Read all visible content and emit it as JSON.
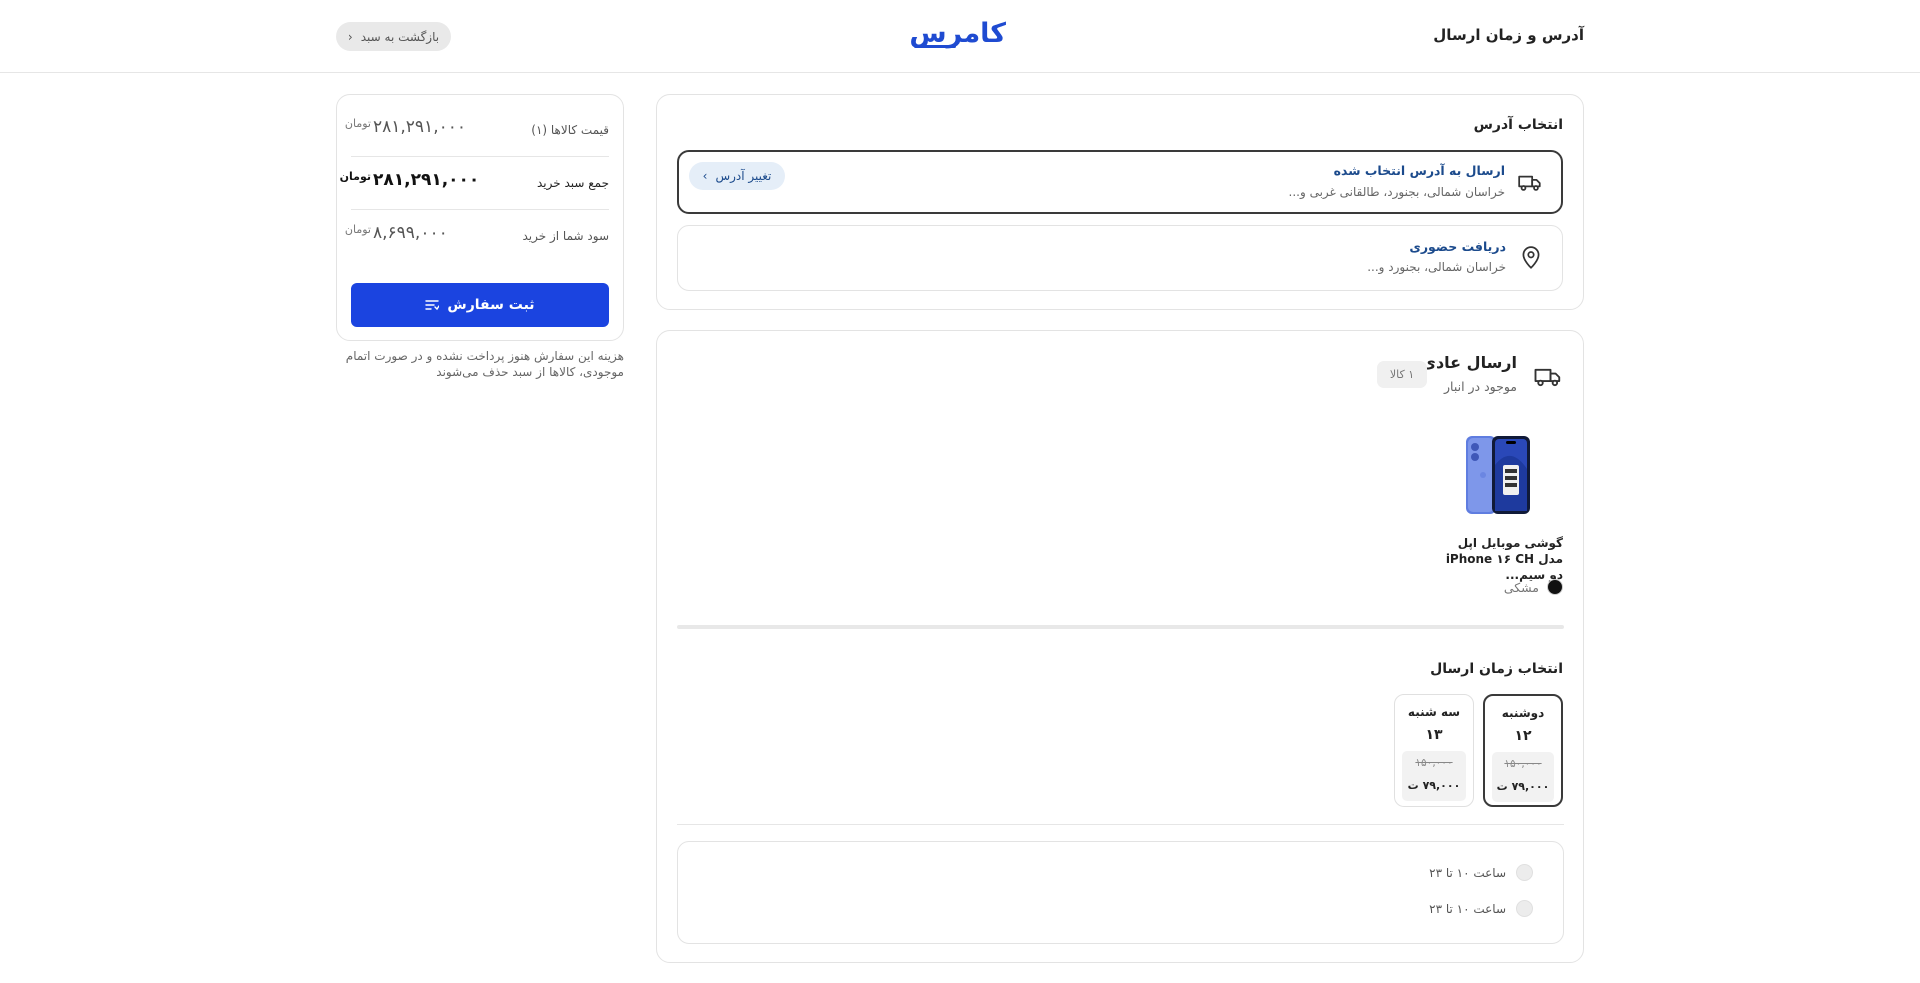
{
  "header": {
    "title": "آدرس و زمان ارسال",
    "logo_text": "کامرس",
    "back_label": "بازگشت به سبد"
  },
  "address": {
    "section_title": "انتخاب آدرس",
    "options": [
      {
        "title": "ارسال به آدرس انتخاب شده",
        "subtitle": "خراسان شمالی، بجنورد، طالقانی غربی و...",
        "icon": "truck-icon",
        "selected": true
      },
      {
        "title": "دریافت حضوری",
        "subtitle": "خراسان شمالی، بجنورد و...",
        "icon": "map-pin-icon",
        "selected": false
      }
    ],
    "change_label": "تغییر آدرس"
  },
  "shipping": {
    "title": "ارسال عادی",
    "subtitle": "موجود در انبار",
    "count": "۱ کالا",
    "product": {
      "name": "گوشی موبایل اپل مدل iPhone ۱۶ CH دو سیم...",
      "color_label": "مشکی",
      "color_hex": "#111111"
    },
    "time_title": "انتخاب زمان ارسال",
    "days": [
      {
        "name": "دوشنبه",
        "num": "۱۲",
        "old_price": "۱۵۰,۰۰۰",
        "new_price": "۷۹,۰۰۰ ت",
        "selected": true
      },
      {
        "name": "سه شنبه",
        "num": "۱۳",
        "old_price": "۱۵۰,۰۰۰",
        "new_price": "۷۹,۰۰۰ ت",
        "selected": false
      }
    ],
    "slots": [
      "ساعت ۱۰ تا ۲۳",
      "ساعت ۱۰ تا ۲۳"
    ]
  },
  "summary": {
    "rows": [
      {
        "label": "قیمت کالاها (۱)",
        "amount": "۲۸۱,۲۹۱,۰۰۰",
        "currency": "تومان"
      },
      {
        "label": "جمع سبد خرید",
        "amount": "۲۸۱,۲۹۱,۰۰۰",
        "currency": "تومان"
      },
      {
        "label": "سود شما از خرید",
        "amount": "۸,۶۹۹,۰۰۰",
        "currency": "تومان"
      }
    ],
    "submit_label": "ثبت سفارش",
    "note": "هزینه این سفارش هنوز پرداخت نشده و در صورت اتمام موجودی، کالاها از سبد حذف می‌شوند"
  },
  "colors": {
    "brand": "#1f4bd1",
    "primary_button": "#1b44e0",
    "link": "#1b4a8c"
  }
}
